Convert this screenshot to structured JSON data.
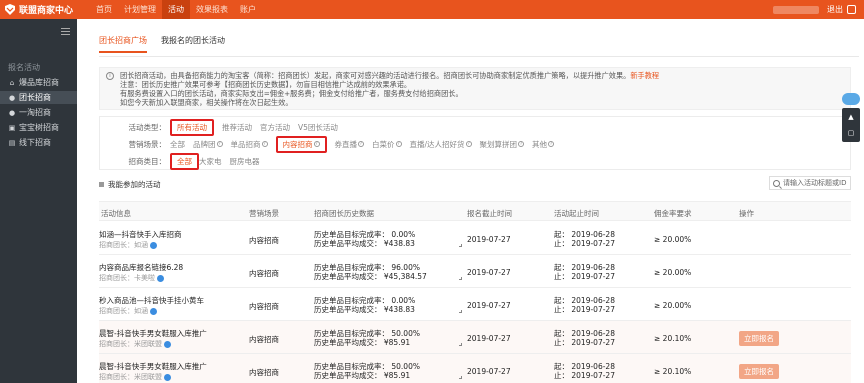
{
  "header": {
    "brand": "联盟商家中心",
    "nav": [
      "首页",
      "计划管理",
      "活动",
      "效果报表",
      "账户"
    ],
    "active_nav": "活动",
    "logout": "退出"
  },
  "sidebar": {
    "section_title": "报名活动",
    "items": [
      {
        "label": "爆品库招商",
        "icon": "home-icon"
      },
      {
        "label": "团长招商",
        "icon": "person-icon",
        "active": true
      },
      {
        "label": "一淘招商",
        "icon": "circle-icon"
      },
      {
        "label": "宝宝树招商",
        "icon": "bag-icon"
      },
      {
        "label": "线下招商",
        "icon": "shop-icon"
      }
    ]
  },
  "tabs": [
    "团长招商广场",
    "我报名的团长活动"
  ],
  "notice": {
    "line1": "团长招商活动，由具备招商能力的淘宝客（简称：招商团长）发起，商家可对感兴趣的活动进行报名。招商团长可协助商家制定优质推广策略，以提升推广效果。",
    "link": "新手教程",
    "line2": "注意：团长历史推广效果可参考【招商团长历史数据】，勿盲目相信推广达成前的效果承诺。",
    "line3": "有服务费设置入口的团长活动，商家实际支出=佣金+服务费；佣金支付给推广者，服务费支付给招商团长。",
    "line4": "如您今天新加入联盟商家，相关操作将在次日起生效。"
  },
  "filters": {
    "type": {
      "label": "活动类型：",
      "options": [
        "所有活动",
        "推荐活动",
        "官方活动",
        "V5团长活动"
      ]
    },
    "scene": {
      "label": "营销场景：",
      "options": [
        "全部",
        "品牌团",
        "单品招商",
        "内容招商",
        "券直播",
        "白菜价",
        "直播/达人招好货",
        "聚划算拼团",
        "其他"
      ]
    },
    "category": {
      "label": "招商类目：",
      "options": [
        "全部",
        "大家电",
        "厨房电器"
      ]
    }
  },
  "list": {
    "title": "我能参加的活动",
    "search_placeholder": "请输入活动标题或ID",
    "columns": [
      "活动信息",
      "营销场景",
      "招商团长历史数据",
      "报名截止时间",
      "活动起止时间",
      "佣金率要求",
      "操作"
    ],
    "rows": [
      {
        "name": "如涵—抖音快手入库招商",
        "leader": "招商团长：如涵",
        "scene": "内容招商",
        "h1": "历史单品目标完成率：  0.00%",
        "h2": "历史单品平均成交：  ¥438.83",
        "deadline": "2019-07-27",
        "start": "起：  2019-06-28",
        "end": "止：  2019-07-27",
        "commission": "≥ 20.00%",
        "op": ""
      },
      {
        "name": "内容商品库报名链接6.28",
        "leader": "招商团长：卡美啦",
        "scene": "内容招商",
        "h1": "历史单品目标完成率：  96.00%",
        "h2": "历史单品平均成交：  ¥45,384.57",
        "deadline": "2019-07-27",
        "start": "起：  2019-06-28",
        "end": "止：  2019-07-27",
        "commission": "≥ 20.00%",
        "op": ""
      },
      {
        "name": "秒入商品池—抖音快手挂小黄车",
        "leader": "招商团长：如涵",
        "scene": "内容招商",
        "h1": "历史单品目标完成率：  0.00%",
        "h2": "历史单品平均成交：  ¥438.83",
        "deadline": "2019-07-27",
        "start": "起：  2019-06-28",
        "end": "止：  2019-07-27",
        "commission": "≥ 20.00%",
        "op": ""
      },
      {
        "name": "晨智-抖音快手男女鞋服入库推广",
        "leader": "招商团长：米团联盟",
        "scene": "内容招商",
        "h1": "历史单品目标完成率：  50.00%",
        "h2": "历史单品平均成交：  ¥85.91",
        "deadline": "2019-07-27",
        "start": "起：  2019-06-28",
        "end": "止：  2019-07-27",
        "commission": "≥ 20.10%",
        "op": "立即报名"
      },
      {
        "name": "晨智-抖音快手男女鞋服入库推广",
        "leader": "招商团长：米团联盟",
        "scene": "内容招商",
        "h1": "历史单品目标完成率：  50.00%",
        "h2": "历史单品平均成交：  ¥85.91",
        "deadline": "2019-07-27",
        "start": "起：  2019-06-28",
        "end": "止：  2019-07-27",
        "commission": "≥ 20.10%",
        "op": "立即报名"
      }
    ]
  },
  "colors": {
    "brand": "#e8541e",
    "sidebar": "#2f353b",
    "highlight_box": "#e02020"
  }
}
